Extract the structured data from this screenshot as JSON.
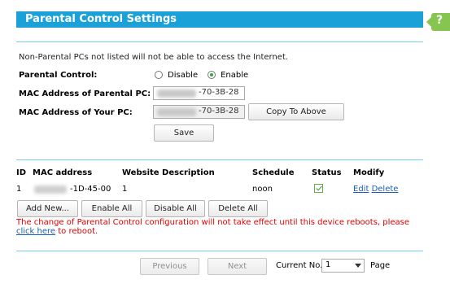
{
  "header": {
    "title": "Parental Control Settings",
    "help_label": "?"
  },
  "note": "Non-Parental PCs not listed will not be able to access the Internet.",
  "form": {
    "parental_control_label": "Parental Control:",
    "disable_label": "Disable",
    "enable_label": "Enable",
    "selected": "Enable",
    "parental_mac_label": "MAC Address of Parental PC:",
    "parental_mac_value": "-70-3B-28",
    "your_mac_label": "MAC Address of Your PC:",
    "your_mac_value": "-70-3B-28",
    "copy_button": "Copy To Above",
    "save_button": "Save"
  },
  "table": {
    "headers": [
      "ID",
      "MAC address",
      "Website Description",
      "Schedule",
      "Status",
      "Modify"
    ],
    "rows": [
      {
        "id": "1",
        "mac": "-1D-45-00",
        "description": "1",
        "schedule": "noon",
        "status_enabled": true,
        "edit": "Edit",
        "delete": "Delete"
      }
    ]
  },
  "actions": {
    "add_new": "Add New...",
    "enable_all": "Enable All",
    "disable_all": "Disable All",
    "delete_all": "Delete All"
  },
  "warning": {
    "text": "The change of Parental Control configuration will not take effect until this device reboots, please ",
    "link": "click here",
    "suffix": " to reboot."
  },
  "pagination": {
    "previous": "Previous",
    "next": "Next",
    "current_label": "Current No.",
    "current_value": "1",
    "page_label": "Page"
  },
  "colors": {
    "header": "#1aa1d8",
    "help": "#86c54f",
    "warning": "#e00000",
    "link": "#1a5fb4"
  }
}
